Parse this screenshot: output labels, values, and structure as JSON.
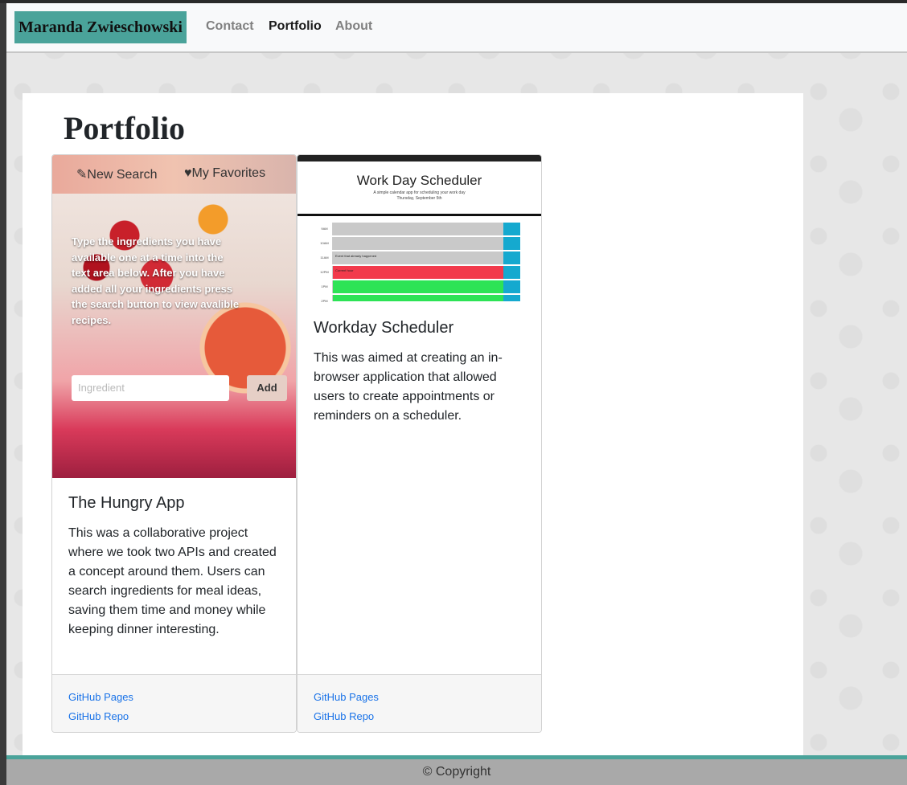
{
  "nav": {
    "brand": "Maranda Zwieschowski",
    "links": [
      "Contact",
      "Portfolio",
      "About"
    ]
  },
  "main": {
    "title": "Portfolio",
    "cards": [
      {
        "title": "The Hungry App",
        "text": "This was a collaborative project where we took two APIs and created a concept around them. Users can search ingredients for meal ideas, saving them time and money while keeping dinner interesting.",
        "links": [
          "GitHub Pages",
          "GitHub Repo"
        ],
        "screenshot": {
          "new_search": "New Search",
          "favorites": "My Favorites",
          "instructions": "Type the ingredients you have available one at a time into the text area below. After you have added all your ingredients press the search button to view avalible recipes.",
          "input_placeholder": "Ingredient",
          "add_label": "Add"
        }
      },
      {
        "title": "Workday Scheduler",
        "text": "This was aimed at creating an in-browser application that allowed users to create appointments or reminders on a scheduler.",
        "links": [
          "GitHub Pages",
          "GitHub Repo"
        ],
        "screenshot": {
          "title": "Work Day Scheduler",
          "subtitle": "A simple calendar app for scheduling your work day",
          "date": "Thursday, September 5th",
          "rows": [
            {
              "hour": "9AM",
              "event": "",
              "color": "#c9c9c9"
            },
            {
              "hour": "10AM",
              "event": "",
              "color": "#c9c9c9"
            },
            {
              "hour": "11AM",
              "event": "Event that already happened",
              "color": "#c9c9c9"
            },
            {
              "hour": "12PM",
              "event": "Current hour",
              "color": "#f23a4c"
            },
            {
              "hour": "1PM",
              "event": "",
              "color": "#2de356"
            },
            {
              "hour": "2PM",
              "event": "",
              "color": "#2de356"
            }
          ]
        }
      }
    ]
  },
  "footer": {
    "text": "© Copyright"
  }
}
